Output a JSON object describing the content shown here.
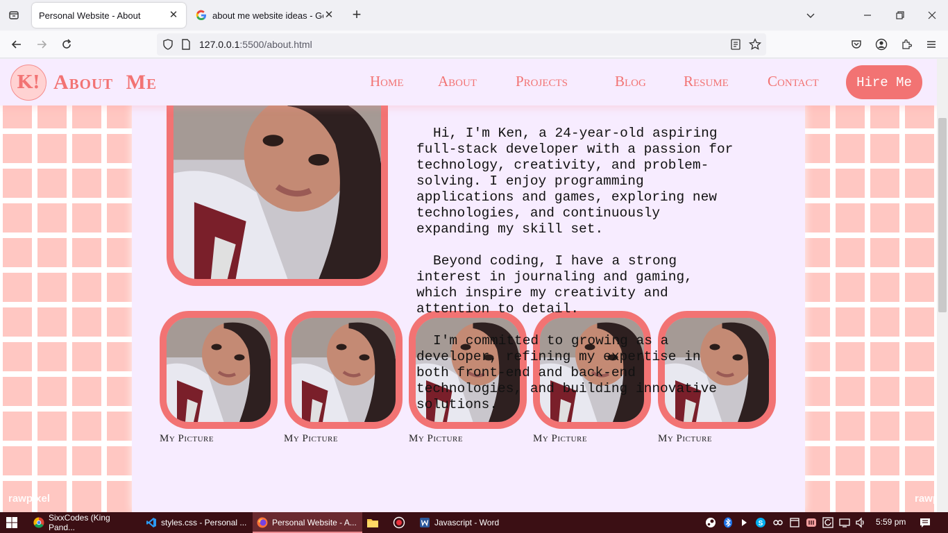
{
  "browser": {
    "tabs": [
      {
        "title": "Personal Website - About",
        "active": true
      },
      {
        "title": "about me website ideas - Goog",
        "active": false
      }
    ],
    "url_host": "127.0.0.1",
    "url_rest": ":5500/about.html"
  },
  "site": {
    "logo_text": "K!",
    "title": "About Me",
    "nav": [
      "Home",
      "About",
      "Projects",
      "Blog",
      "Resume",
      "Contact"
    ],
    "hire_label": "Hire Me",
    "bio": [
      "Hi, I'm Ken, a 24-year-old aspiring full-stack developer with a passion for technology, creativity, and problem-solving. I enjoy programming applications and games, exploring new technologies, and continuously expanding my skill set.",
      "Beyond coding, I have a strong interest in journaling and gaming, which inspire my creativity and attention to detail.",
      "I'm committed to growing as a developer, refining my expertise in both front-end and back-end technologies, and building innovative solutions."
    ],
    "gallery_caption": "My Picture",
    "watermark": "rawpixel"
  },
  "taskbar": {
    "items": [
      {
        "label": "SixxCodes (King Pand...",
        "icon": "chrome-icon"
      },
      {
        "label": "styles.css - Personal ...",
        "icon": "vscode-icon"
      },
      {
        "label": "Personal Website - A...",
        "icon": "firefox-icon"
      },
      {
        "label": "Javascript - Word",
        "icon": "word-icon"
      }
    ],
    "time": "5:59 pm"
  },
  "colors": {
    "accent": "#f27373",
    "panel": "#f7ecff",
    "grid": "#ffc7c2"
  }
}
